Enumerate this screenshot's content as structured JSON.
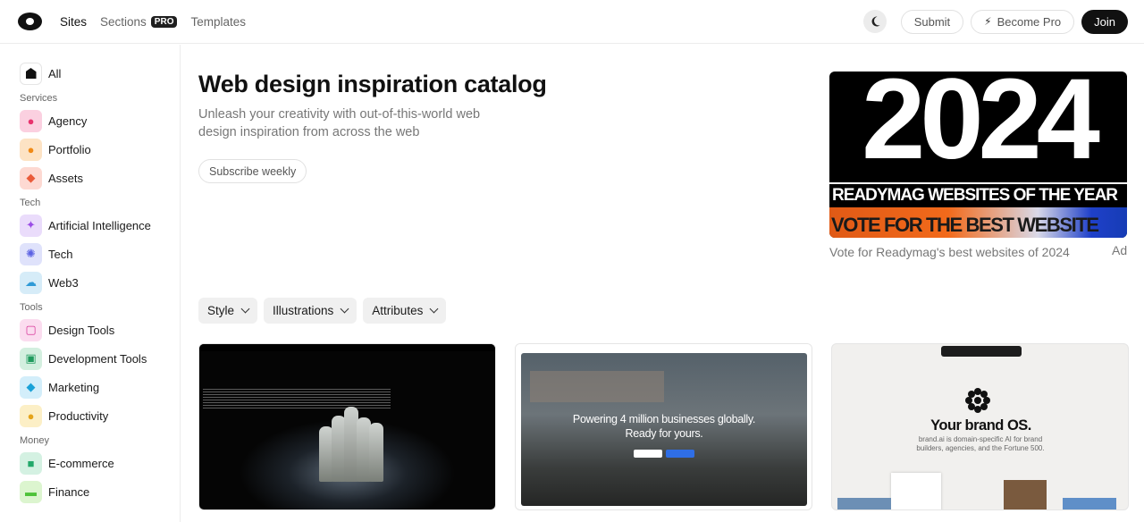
{
  "topbar": {
    "nav": [
      {
        "label": "Sites",
        "active": true
      },
      {
        "label": "Sections",
        "badge": "PRO"
      },
      {
        "label": "Templates"
      }
    ],
    "submit_label": "Submit",
    "become_pro_label": "Become Pro",
    "join_label": "Join"
  },
  "sidebar": {
    "all_label": "All",
    "groups": [
      {
        "title": "Services",
        "items": [
          "Agency",
          "Portfolio",
          "Assets"
        ]
      },
      {
        "title": "Tech",
        "items": [
          "Artificial Intelligence",
          "Tech",
          "Web3"
        ]
      },
      {
        "title": "Tools",
        "items": [
          "Design Tools",
          "Development Tools",
          "Marketing",
          "Productivity"
        ]
      },
      {
        "title": "Money",
        "items": [
          "E-commerce",
          "Finance"
        ]
      }
    ],
    "icon_colors": {
      "Agency": "#fbd0e0",
      "Portfolio": "#fde3c4",
      "Assets": "#fdd9d2",
      "Artificial Intelligence": "#eadcfb",
      "Tech": "#dfe2fb",
      "Web3": "#d6ecf8",
      "Design Tools": "#fbdcef",
      "Development Tools": "#d3efdf",
      "Marketing": "#d3eefa",
      "Productivity": "#fcefc6",
      "E-commerce": "#d4f1e2",
      "Finance": "#dcf5cf"
    }
  },
  "hero": {
    "title": "Web design inspiration catalog",
    "subtitle": "Unleash your creativity with out-of-this-world web design inspiration from across the web",
    "subscribe_label": "Subscribe weekly"
  },
  "ad": {
    "year": "2024",
    "band": "READYMAG WEBSITES OF THE YEAR",
    "vote": "VOTE FOR THE BEST WEBSITE",
    "caption": "Vote for Readymag's best websites of 2024",
    "label": "Ad"
  },
  "filters": [
    "Style",
    "Illustrations",
    "Attributes"
  ],
  "cards": [
    {
      "type": "fashion-photo"
    },
    {
      "headline_line1": "Powering 4 million businesses globally.",
      "headline_line2": "Ready for yours."
    },
    {
      "headline": "Your brand OS.",
      "sub": "brand.ai is domain-specific AI for brand builders, agencies, and the Fortune 500."
    }
  ]
}
